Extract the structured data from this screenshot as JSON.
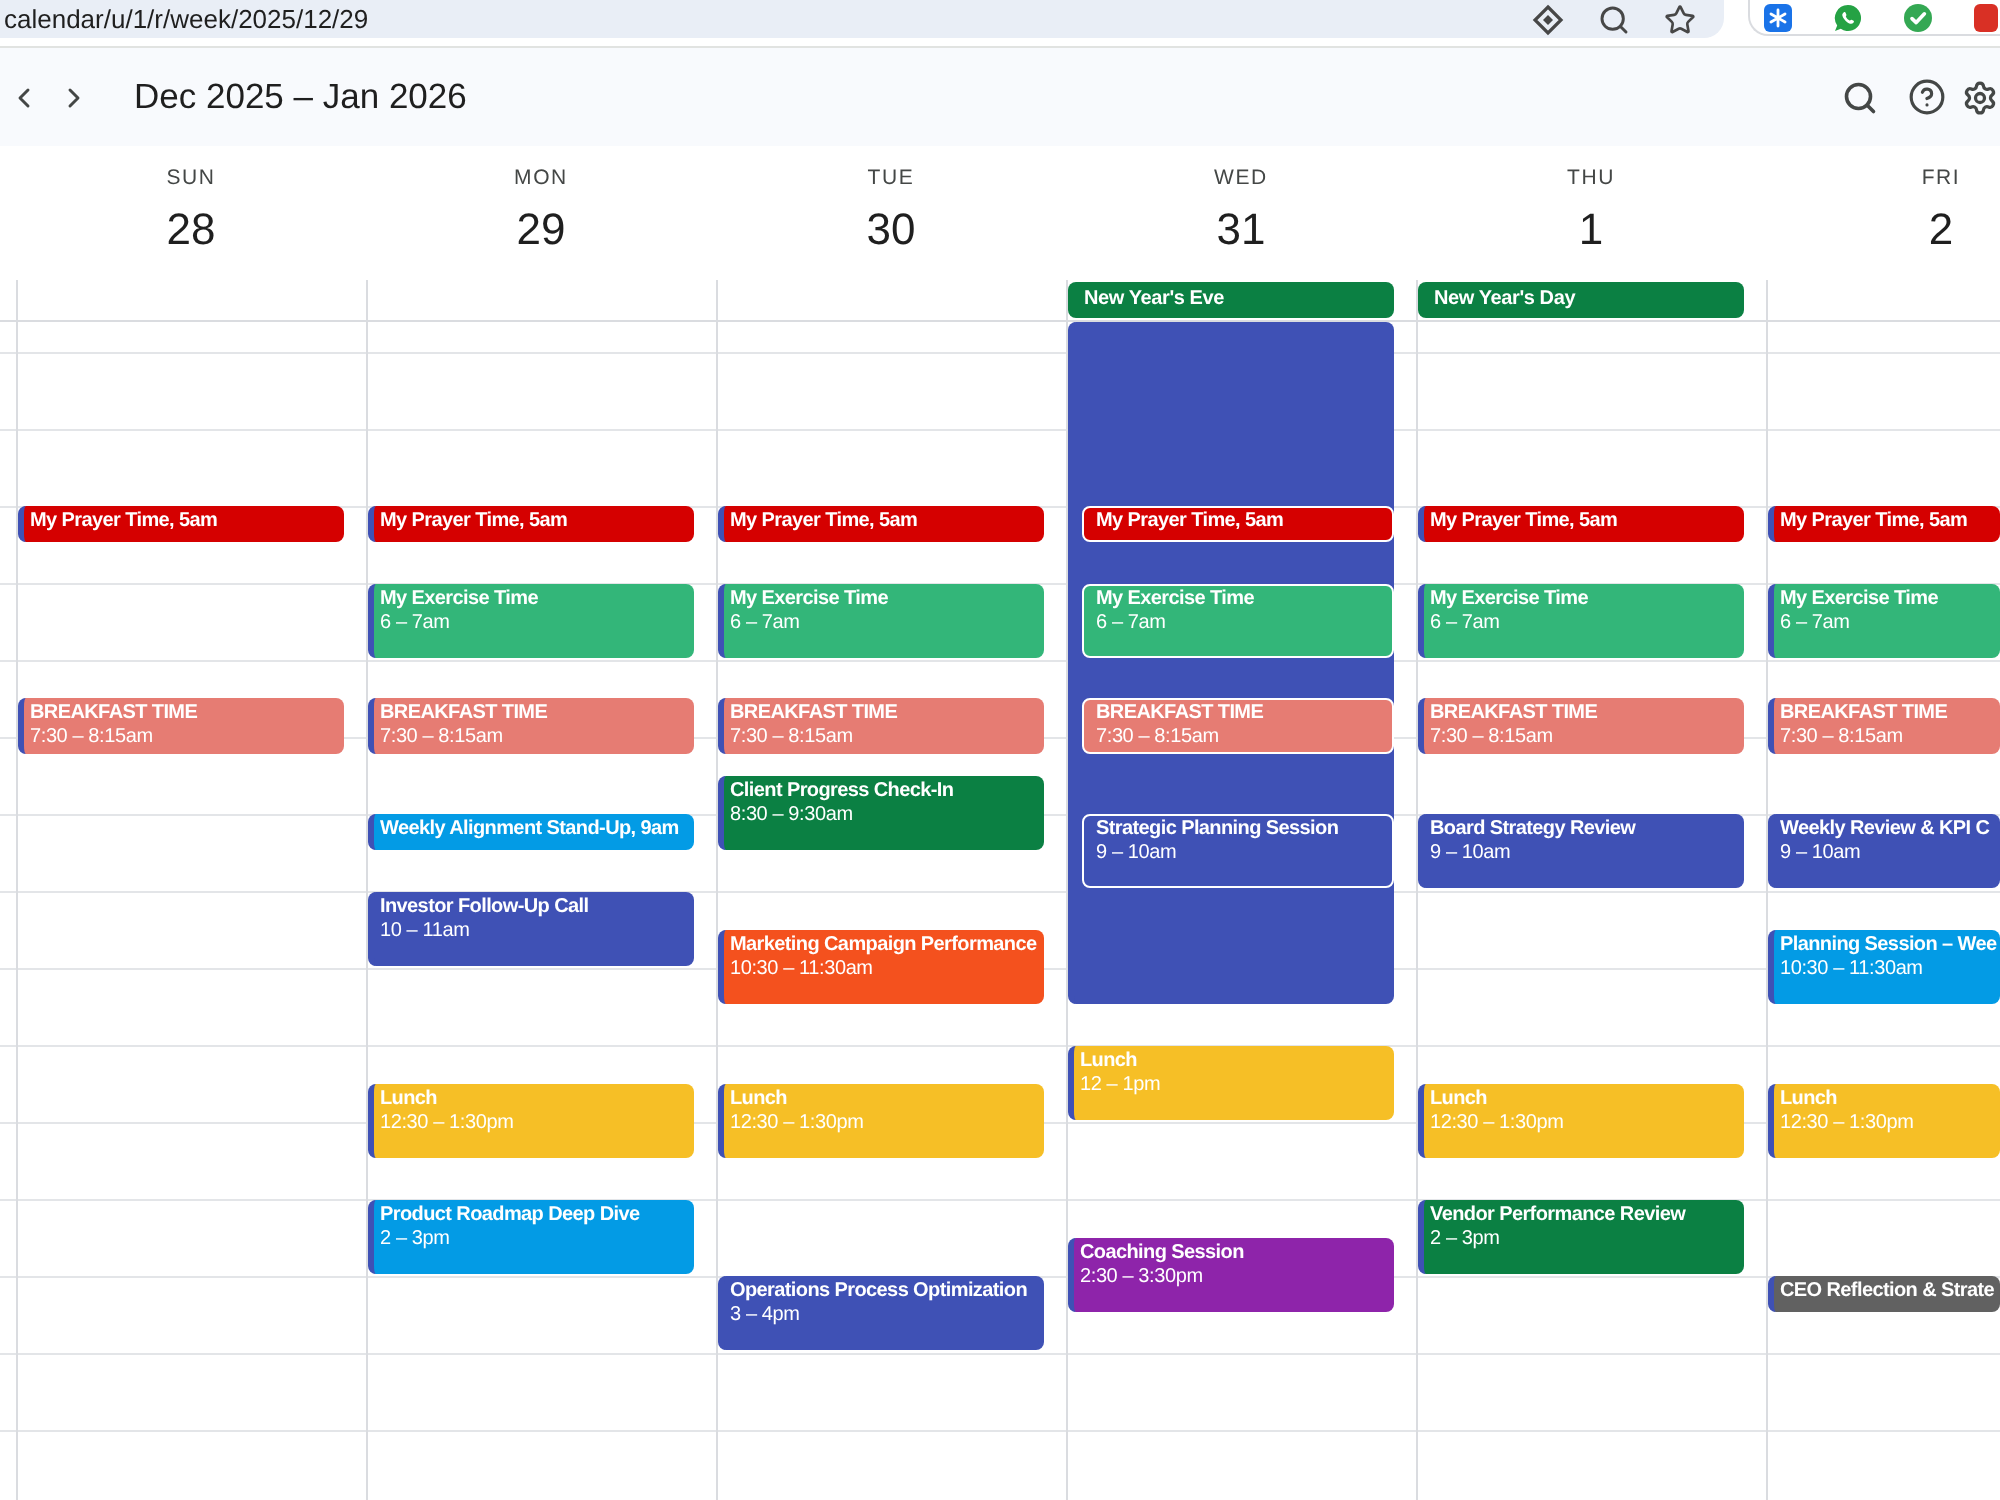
{
  "browser": {
    "url": "calendar/u/1/r/week/2025/12/29"
  },
  "header": {
    "title": "Dec 2025 – Jan 2026"
  },
  "days": [
    {
      "weekday": "SUN",
      "date": "28",
      "events": [
        {
          "title": "My Prayer Time, 5am",
          "color": "#d50000"
        },
        {
          "title": "BREAKFAST TIME",
          "time": "7:30 – 8:15am",
          "color": "#e67c73"
        }
      ]
    },
    {
      "weekday": "MON",
      "date": "29",
      "events": [
        {
          "title": "My Prayer Time, 5am",
          "color": "#d50000"
        },
        {
          "title": "My Exercise Time",
          "time": "6 – 7am",
          "color": "#33b679"
        },
        {
          "title": "BREAKFAST TIME",
          "time": "7:30 – 8:15am",
          "color": "#e67c73"
        },
        {
          "title": "Weekly Alignment Stand-Up, 9am",
          "color": "#039be5"
        },
        {
          "title": "Investor Follow-Up Call",
          "time": "10 – 11am",
          "color": "#3f51b5"
        },
        {
          "title": "Lunch",
          "time": "12:30 – 1:30pm",
          "color": "#f6bf26"
        },
        {
          "title": "Product Roadmap Deep Dive",
          "time": "2 – 3pm",
          "color": "#039be5"
        }
      ]
    },
    {
      "weekday": "TUE",
      "date": "30",
      "events": [
        {
          "title": "My Prayer Time, 5am",
          "color": "#d50000"
        },
        {
          "title": "My Exercise Time",
          "time": "6 – 7am",
          "color": "#33b679"
        },
        {
          "title": "BREAKFAST TIME",
          "time": "7:30 – 8:15am",
          "color": "#e67c73"
        },
        {
          "title": "Client Progress Check-In",
          "time": "8:30 – 9:30am",
          "color": "#0b8043"
        },
        {
          "title": "Marketing Campaign Performance",
          "time": "10:30 – 11:30am",
          "color": "#f4511e"
        },
        {
          "title": "Lunch",
          "time": "12:30 – 1:30pm",
          "color": "#f6bf26"
        },
        {
          "title": "Operations Process Optimization",
          "time": "3 – 4pm",
          "color": "#3f51b5"
        }
      ]
    },
    {
      "weekday": "WED",
      "date": "31",
      "all_day": [
        {
          "title": "New Year's Eve",
          "color": "#0b8043"
        }
      ],
      "events": [
        {
          "color": "#3f51b5"
        },
        {
          "title": "My Prayer Time, 5am",
          "color": "#d50000"
        },
        {
          "title": "My Exercise Time",
          "time": "6 – 7am",
          "color": "#33b679"
        },
        {
          "title": "BREAKFAST TIME",
          "time": "7:30 – 8:15am",
          "color": "#e67c73"
        },
        {
          "title": "Strategic Planning Session",
          "time": "9 – 10am",
          "color": "#3f51b5"
        },
        {
          "title": "Lunch",
          "time": "12 – 1pm",
          "color": "#f6bf26"
        },
        {
          "title": "Coaching Session",
          "time": "2:30 – 3:30pm",
          "color": "#8e24aa"
        }
      ]
    },
    {
      "weekday": "THU",
      "date": "1",
      "all_day": [
        {
          "title": "New Year's Day",
          "color": "#0b8043"
        }
      ],
      "events": [
        {
          "title": "My Prayer Time, 5am",
          "color": "#d50000"
        },
        {
          "title": "My Exercise Time",
          "time": "6 – 7am",
          "color": "#33b679"
        },
        {
          "title": "BREAKFAST TIME",
          "time": "7:30 – 8:15am",
          "color": "#e67c73"
        },
        {
          "title": "Board Strategy Review",
          "time": "9 – 10am",
          "color": "#3f51b5"
        },
        {
          "title": "Lunch",
          "time": "12:30 – 1:30pm",
          "color": "#f6bf26"
        },
        {
          "title": "Vendor Performance Review",
          "time": "2 – 3pm",
          "color": "#0b8043"
        }
      ]
    },
    {
      "weekday": "FRI",
      "date": "2",
      "events": [
        {
          "title": "My Prayer Time, 5am",
          "color": "#d50000"
        },
        {
          "title": "My Exercise Time",
          "time": "6 – 7am",
          "color": "#33b679"
        },
        {
          "title": "BREAKFAST TIME",
          "time": "7:30 – 8:15am",
          "color": "#e67c73"
        },
        {
          "title": "Weekly Review & KPI C",
          "time": "9 – 10am",
          "color": "#3f51b5"
        },
        {
          "title": "Planning Session – Wee",
          "time": "10:30 – 11:30am",
          "color": "#039be5"
        },
        {
          "title": "Lunch",
          "time": "12:30 – 1:30pm",
          "color": "#f6bf26"
        },
        {
          "title": "CEO Reflection & Strate",
          "color": "#616161"
        }
      ]
    }
  ]
}
